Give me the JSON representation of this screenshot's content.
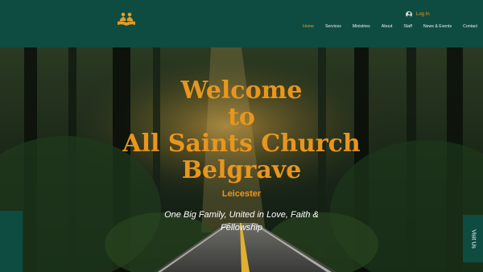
{
  "header": {
    "logo_icon": "church-logo-icon",
    "login_label": "Log In",
    "nav": [
      "Home",
      "Services",
      "Ministries",
      "About",
      "Staff",
      "News & Events",
      "Contact"
    ],
    "active_nav": "Home"
  },
  "hero": {
    "title_lines": [
      "Welcome",
      "to",
      "All Saints Church",
      "Belgrave"
    ],
    "subtitle": "Leicester",
    "tagline": "One Big Family, United in Love, Faith & Fellowship",
    "background": "forest-road-image"
  },
  "side": {
    "visit_label": "Visit Us"
  },
  "colors": {
    "brand_green": "#0e4c41",
    "accent_orange": "#e79b22",
    "nav_text": "#f1efe6"
  }
}
